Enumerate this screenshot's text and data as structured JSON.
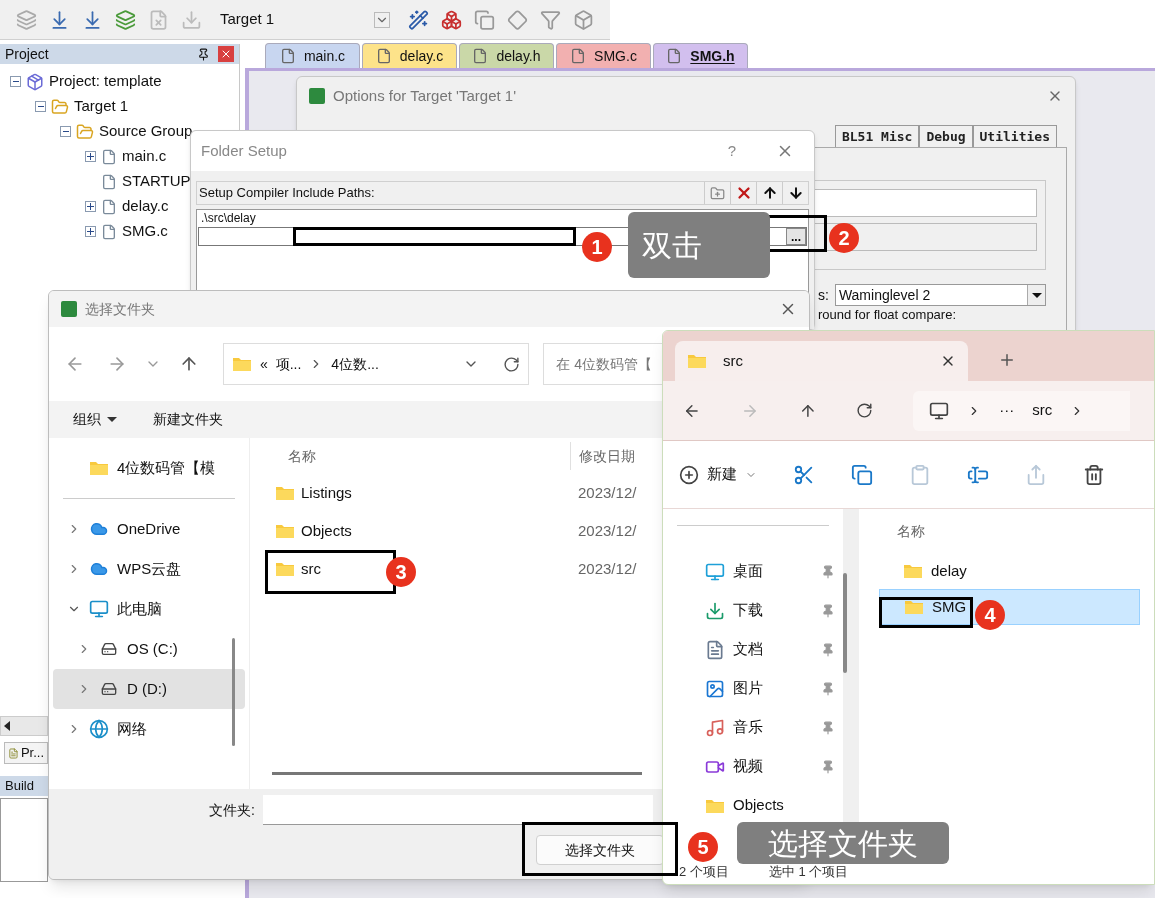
{
  "toolbar": {
    "target": "Target 1"
  },
  "project_panel": {
    "title": "Project",
    "tree": [
      {
        "label": "Project: template",
        "kind": "project",
        "expanded": true,
        "children": [
          {
            "label": "Target 1",
            "kind": "target",
            "expanded": true,
            "children": [
              {
                "label": "Source Group",
                "kind": "group",
                "expanded": true,
                "children": [
                  {
                    "label": "main.c",
                    "kind": "file",
                    "expandable": true
                  },
                  {
                    "label": "STARTUP",
                    "kind": "file",
                    "expandable": false
                  },
                  {
                    "label": "delay.c",
                    "kind": "file",
                    "expandable": true
                  },
                  {
                    "label": "SMG.c",
                    "kind": "file",
                    "expandable": true
                  }
                ]
              }
            ]
          }
        ]
      }
    ],
    "bottom_tab": "Pr...",
    "output_title": "Build"
  },
  "editor_tabs": [
    {
      "label": "main.c",
      "color": "#c8d6f0",
      "selected": false
    },
    {
      "label": "delay.c",
      "color": "#fde38a",
      "selected": false
    },
    {
      "label": "delay.h",
      "color": "#cad8a8",
      "selected": false
    },
    {
      "label": "SMG.c",
      "color": "#f2b0b0",
      "selected": false
    },
    {
      "label": "SMG.h",
      "color": "#d2bfee",
      "selected": true
    }
  ],
  "options_dialog": {
    "title": "Options for Target 'Target 1'",
    "tabs": [
      {
        "label": "BL51 Misc",
        "selected": false
      },
      {
        "label": "Debug",
        "selected": false
      },
      {
        "label": "Utilities",
        "selected": false
      }
    ],
    "warnings": {
      "label": "s:",
      "value": "Waminglevel 2"
    },
    "float_compare": {
      "label": "round for float compare:"
    }
  },
  "folder_setup": {
    "title": "Folder Setup",
    "help": "?",
    "section_label": "Setup Compiler Include Paths:",
    "paths": [
      ".\\src\\delay"
    ],
    "editing": true,
    "browse": "..."
  },
  "choose_folder_dialog": {
    "title": "选择文件夹",
    "address": [
      "«",
      "项...",
      "4位数..."
    ],
    "search_placeholder": "在 4位数码管【",
    "commands": [
      {
        "label": "组织",
        "dropdown": true
      },
      {
        "label": "新建文件夹",
        "dropdown": false
      }
    ],
    "nav": [
      {
        "label": "4位数码管【模",
        "kind": "folder",
        "selected": false
      },
      {
        "label": "OneDrive",
        "kind": "cloud",
        "expanded": false,
        "selected": false
      },
      {
        "label": "WPS云盘",
        "kind": "cloud",
        "expanded": false,
        "selected": false
      },
      {
        "label": "此电脑",
        "kind": "pc",
        "expanded": true,
        "selected": false
      },
      {
        "label": "OS (C:)",
        "kind": "drive",
        "expanded": false,
        "selected": false
      },
      {
        "label": "D (D:)",
        "kind": "drive",
        "expanded": false,
        "selected": true
      },
      {
        "label": "网络",
        "kind": "network",
        "expanded": false,
        "selected": false
      }
    ],
    "columns": [
      "名称",
      "修改日期"
    ],
    "rows": [
      {
        "name": "Listings",
        "date": "2023/12/"
      },
      {
        "name": "Objects",
        "date": "2023/12/"
      },
      {
        "name": "src",
        "date": "2023/12/"
      }
    ],
    "folder_label": "文件夹:",
    "confirm_button": "选择文件夹"
  },
  "explorer": {
    "tab": "src",
    "path": [
      "···",
      "src"
    ],
    "new_label": "新建",
    "nav": [
      {
        "label": "桌面",
        "kind": "desktop",
        "pinned": true
      },
      {
        "label": "下载",
        "kind": "download",
        "pinned": true
      },
      {
        "label": "文档",
        "kind": "document",
        "pinned": true
      },
      {
        "label": "图片",
        "kind": "image",
        "pinned": true
      },
      {
        "label": "音乐",
        "kind": "music",
        "pinned": true
      },
      {
        "label": "视频",
        "kind": "video",
        "pinned": true
      },
      {
        "label": "Objects",
        "kind": "folder",
        "pinned": false
      }
    ],
    "column": "名称",
    "rows": [
      {
        "name": "delay",
        "selected": false
      },
      {
        "name": "SMG",
        "selected": true
      }
    ],
    "status": [
      "2 个项目",
      "选中 1 个项目"
    ]
  },
  "annotations": {
    "markers": [
      "1",
      "2",
      "3",
      "4",
      "5"
    ],
    "callouts": [
      "双击",
      "选择文件夹"
    ]
  }
}
